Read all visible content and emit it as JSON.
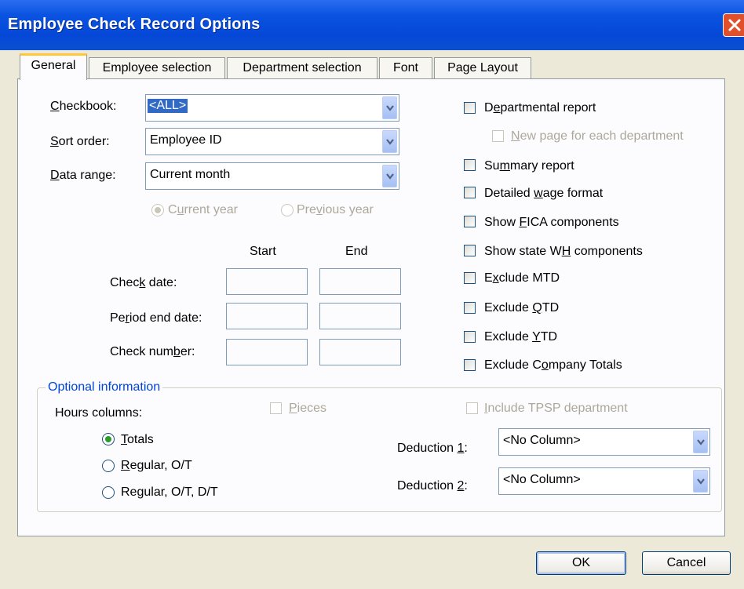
{
  "window": {
    "title": "Employee Check Record Options"
  },
  "tabs": [
    {
      "label": "General",
      "active": true
    },
    {
      "label": "Employee selection"
    },
    {
      "label": "Department selection"
    },
    {
      "label": "Font"
    },
    {
      "label": "Page Layout"
    }
  ],
  "general": {
    "checkbook": {
      "label": "Checkbook:",
      "value": "<ALL>"
    },
    "sort_order": {
      "label": "Sort order:",
      "value": "Employee ID"
    },
    "data_range": {
      "label": "Data range:",
      "value": "Current month"
    },
    "year_radios": [
      {
        "label": "Current year",
        "selected": true,
        "enabled": false
      },
      {
        "label": "Previous year",
        "selected": false,
        "enabled": false
      }
    ],
    "range_headers": {
      "start": "Start",
      "end": "End"
    },
    "range_rows": [
      {
        "label": "Check date:",
        "start": "",
        "end": ""
      },
      {
        "label": "Period end date:",
        "start": "",
        "end": ""
      },
      {
        "label": "Check number:",
        "start": "",
        "end": ""
      }
    ],
    "options": [
      {
        "label": "Departmental report",
        "checked": false,
        "enabled": true
      },
      {
        "label": "New page for each department",
        "checked": false,
        "enabled": false
      },
      {
        "label": "Summary report",
        "checked": false,
        "enabled": true
      },
      {
        "label": "Detailed wage format",
        "checked": false,
        "enabled": true
      },
      {
        "label": "Show FICA components",
        "checked": false,
        "enabled": true
      },
      {
        "label": "Show state WH components",
        "checked": false,
        "enabled": true
      },
      {
        "label": "Exclude MTD",
        "checked": false,
        "enabled": true
      },
      {
        "label": "Exclude QTD",
        "checked": false,
        "enabled": true
      },
      {
        "label": "Exclude YTD",
        "checked": false,
        "enabled": true
      },
      {
        "label": "Exclude Company Totals",
        "checked": false,
        "enabled": true
      }
    ]
  },
  "optional": {
    "title": "Optional information",
    "hours_label": "Hours columns:",
    "hours_radios": [
      {
        "label": "Totals",
        "selected": true
      },
      {
        "label": "Regular, O/T",
        "selected": false
      },
      {
        "label": "Regular, O/T, D/T",
        "selected": false
      }
    ],
    "pieces": {
      "label": "Pieces",
      "checked": false,
      "enabled": false
    },
    "include_tpsp": {
      "label": "Include TPSP department",
      "checked": false,
      "enabled": false
    },
    "deduction1": {
      "label": "Deduction 1:",
      "value": "<No Column>"
    },
    "deduction2": {
      "label": "Deduction 2:",
      "value": "<No Column>"
    }
  },
  "buttons": {
    "ok": "OK",
    "cancel": "Cancel"
  },
  "colors": {
    "title_bar": "#0548d8",
    "group_title": "#0046d5",
    "selection": "#316ac5",
    "close_button": "#e0502c"
  }
}
